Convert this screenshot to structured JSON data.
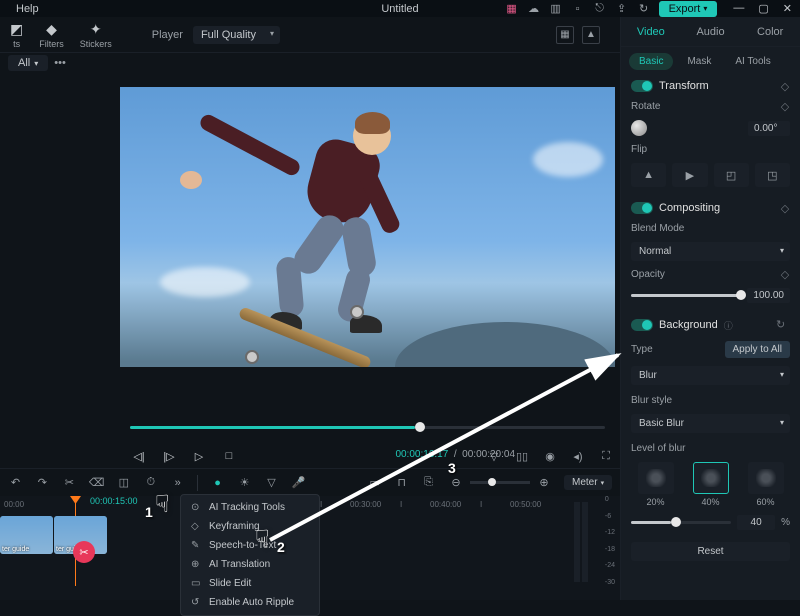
{
  "titlebar": {
    "help": "Help",
    "doc_title": "Untitled",
    "export": "Export"
  },
  "left_tools": [
    {
      "icon": "◩",
      "label": "ts"
    },
    {
      "icon": "◆",
      "label": "Filters"
    },
    {
      "icon": "✦",
      "label": "Stickers"
    }
  ],
  "left_panel": {
    "all": "All"
  },
  "player": {
    "label": "Player",
    "quality": "Full Quality"
  },
  "timecode": {
    "current": "00:00:16:17",
    "total": "00:00:20:04"
  },
  "right_panel": {
    "tabs": [
      "Video",
      "Audio",
      "Color"
    ],
    "subtabs": [
      "Basic",
      "Mask",
      "AI Tools"
    ],
    "transform": "Transform",
    "rotate": {
      "label": "Rotate",
      "value": "0.00°"
    },
    "flip": "Flip",
    "compositing": "Compositing",
    "blend": {
      "label": "Blend Mode",
      "value": "Normal"
    },
    "opacity": {
      "label": "Opacity",
      "value": "100.00"
    },
    "background": "Background",
    "type": {
      "label": "Type",
      "apply": "Apply to All",
      "value": "Blur"
    },
    "blur_style": {
      "label": "Blur style",
      "value": "Basic Blur"
    },
    "level_of_blur": "Level of blur",
    "blur_levels": [
      "20%",
      "40%",
      "60%"
    ],
    "blur_value": "40",
    "pct": "%",
    "reset": "Reset"
  },
  "timeline_bar": {
    "meter": "Meter"
  },
  "ruler": {
    "playhead_time": "00:00:15:00",
    "ticks": [
      "00:00"
    ]
  },
  "ruler2": [
    "I",
    "00:30:00",
    "I",
    "00:40:00",
    "I",
    "00:50:00"
  ],
  "clip_label": "ter guide",
  "ctx_menu": [
    {
      "icon": "⊙",
      "label": "AI Tracking Tools"
    },
    {
      "icon": "◇",
      "label": "Keyframing"
    },
    {
      "icon": "✎",
      "label": "Speech-to-Text"
    },
    {
      "icon": "⊕",
      "label": "AI Translation"
    },
    {
      "icon": "▭",
      "label": "Slide Edit"
    },
    {
      "icon": "↺",
      "label": "Enable Auto Ripple"
    }
  ],
  "meter_scale": [
    "0",
    "-6",
    "-12",
    "-18",
    "-24",
    "-30"
  ],
  "annotations": {
    "n1": "1",
    "n2": "2",
    "n3": "3"
  }
}
